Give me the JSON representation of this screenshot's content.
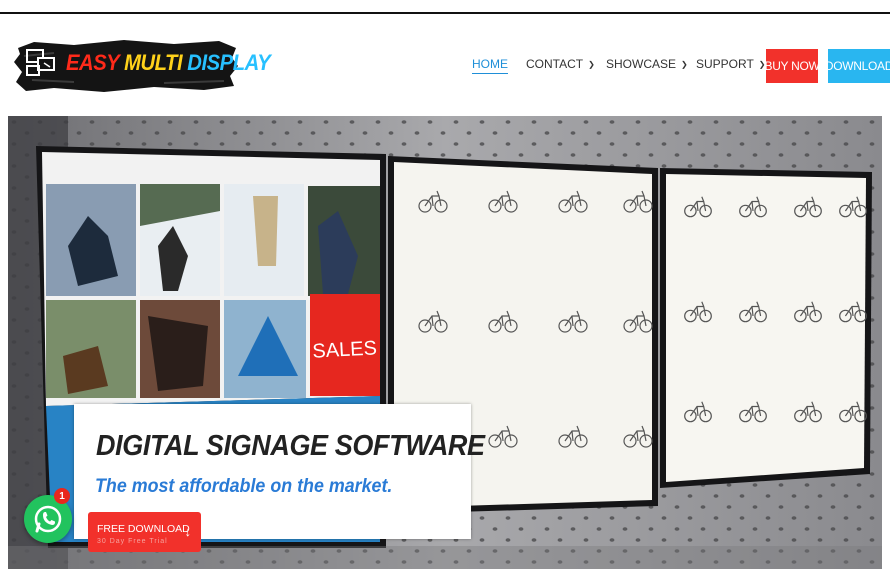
{
  "header": {
    "logo": {
      "word1": "EASY",
      "word2": "MULTI",
      "word3": "DISPLAY"
    },
    "nav": [
      {
        "label": "HOME",
        "active": true,
        "dropdown": false
      },
      {
        "label": "CONTACT",
        "active": false,
        "dropdown": true
      },
      {
        "label": "SHOWCASE",
        "active": false,
        "dropdown": true
      },
      {
        "label": "SUPPORT",
        "active": false,
        "dropdown": true
      }
    ],
    "buy_now_label": "BUY NOW",
    "download_label": "DOWNLOAD"
  },
  "hero": {
    "screen_text": {
      "sales": "SALES"
    },
    "cta": {
      "title": "DIGITAL SIGNAGE SOFTWARE",
      "subtitle": "The most affordable on the market.",
      "button_label": "FREE DOWNLOAD",
      "button_sublabel": "30 Day Free Trial",
      "button_icon": "arrow-down-icon"
    }
  },
  "whatsapp": {
    "icon": "whatsapp-icon",
    "badge_count": "1"
  },
  "colors": {
    "accent_blue": "#1f8fd8",
    "buy_red": "#f2312b",
    "download_blue": "#29b6f0",
    "subtitle_blue": "#2a7bd6",
    "whatsapp_green": "#22c35e"
  }
}
